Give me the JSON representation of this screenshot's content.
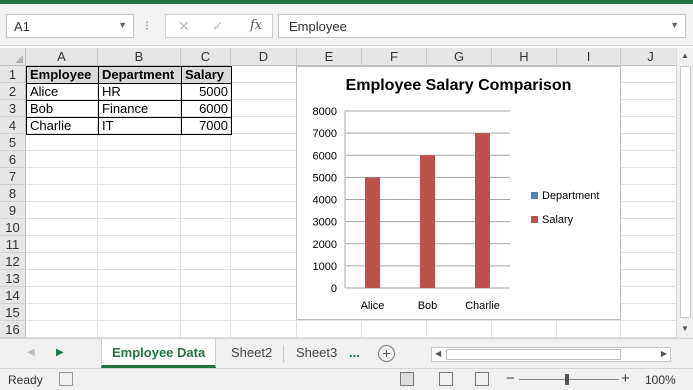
{
  "formula_bar": {
    "name_box": "A1",
    "formula_value": "Employee",
    "cancel_icon": "✕",
    "enter_icon": "✓",
    "fx_label": "fx"
  },
  "columns": [
    "A",
    "B",
    "C",
    "D",
    "E",
    "F",
    "G",
    "H",
    "I",
    "J"
  ],
  "rows": [
    "1",
    "2",
    "3",
    "4",
    "5",
    "6",
    "7",
    "8",
    "9",
    "10",
    "11",
    "12",
    "13",
    "14",
    "15",
    "16"
  ],
  "table": {
    "headers": [
      "Employee",
      "Department",
      "Salary"
    ],
    "rows": [
      [
        "Alice",
        "HR",
        "5000"
      ],
      [
        "Bob",
        "Finance",
        "6000"
      ],
      [
        "Charlie",
        "IT",
        "7000"
      ]
    ]
  },
  "chart_data": {
    "type": "bar",
    "title": "Employee Salary Comparison",
    "categories": [
      "Alice",
      "Bob",
      "Charlie"
    ],
    "series": [
      {
        "name": "Department",
        "values": [
          0,
          0,
          0
        ],
        "color": "#4f81bd"
      },
      {
        "name": "Salary",
        "values": [
          5000,
          6000,
          7000
        ],
        "color": "#c0504d"
      }
    ],
    "ylim": [
      0,
      8000
    ],
    "yticks": [
      "0",
      "1000",
      "2000",
      "3000",
      "4000",
      "5000",
      "6000",
      "7000",
      "8000"
    ],
    "grid": true,
    "legend_position": "right"
  },
  "sheets": {
    "tabs": [
      "Employee Data",
      "Sheet2",
      "Sheet3"
    ],
    "active": "Employee Data",
    "more": "...",
    "add_icon": "+"
  },
  "status": {
    "ready": "Ready",
    "zoom": "100%",
    "zoom_minus": "−",
    "zoom_plus": "+"
  },
  "colors": {
    "accent": "#217346"
  }
}
